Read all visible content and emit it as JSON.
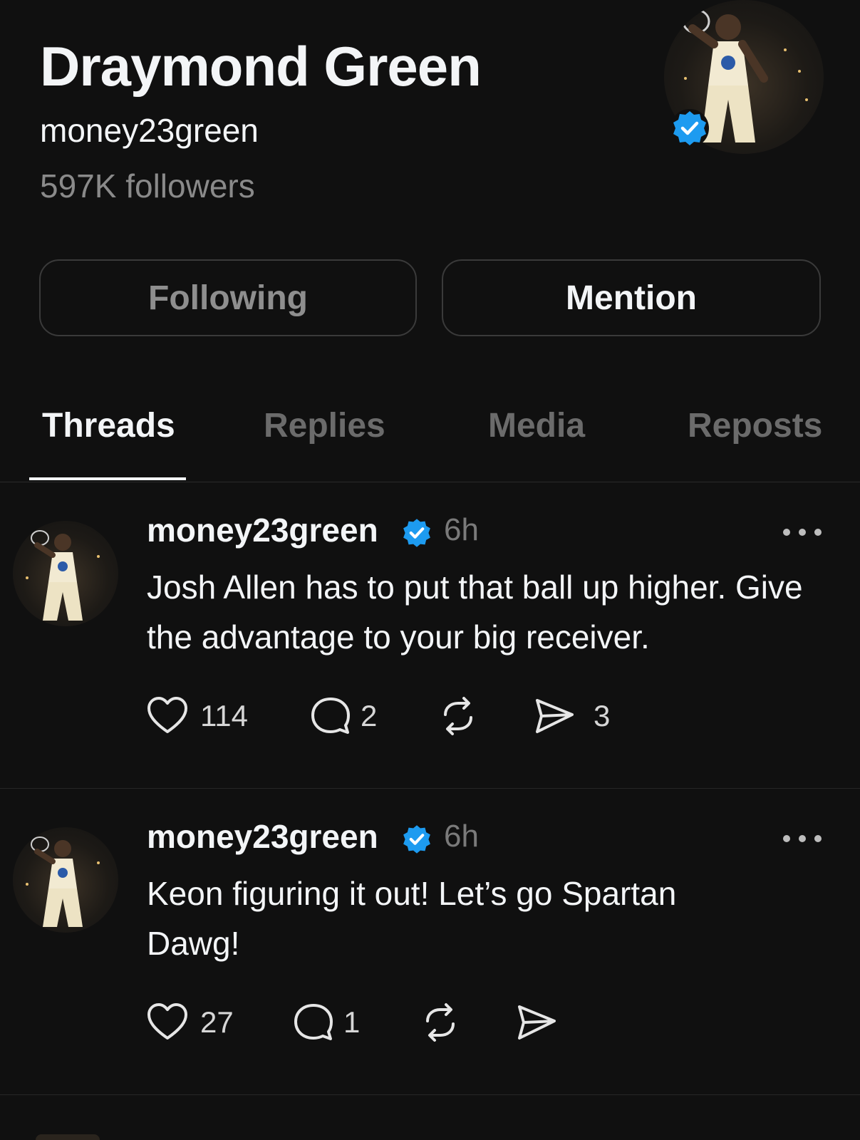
{
  "profile": {
    "name": "Draymond Green",
    "handle": "money23green",
    "followers": "597K followers"
  },
  "buttons": {
    "following": "Following",
    "mention": "Mention"
  },
  "tabs": [
    "Threads",
    "Replies",
    "Media",
    "Reposts"
  ],
  "posts": [
    {
      "user": "money23green",
      "time": "6h",
      "text": "Josh Allen has to put that ball up higher. Give the advantage to your big receiver.",
      "likes": "114",
      "replies": "2",
      "shares": "3"
    },
    {
      "user": "money23green",
      "time": "6h",
      "text": "Keon figuring it out! Let’s go Spartan Dawg!",
      "likes": "27",
      "replies": "1",
      "shares": ""
    }
  ],
  "colors": {
    "verified": "#1d9bf0",
    "background": "#101010",
    "muted": "#8a8a8a"
  }
}
